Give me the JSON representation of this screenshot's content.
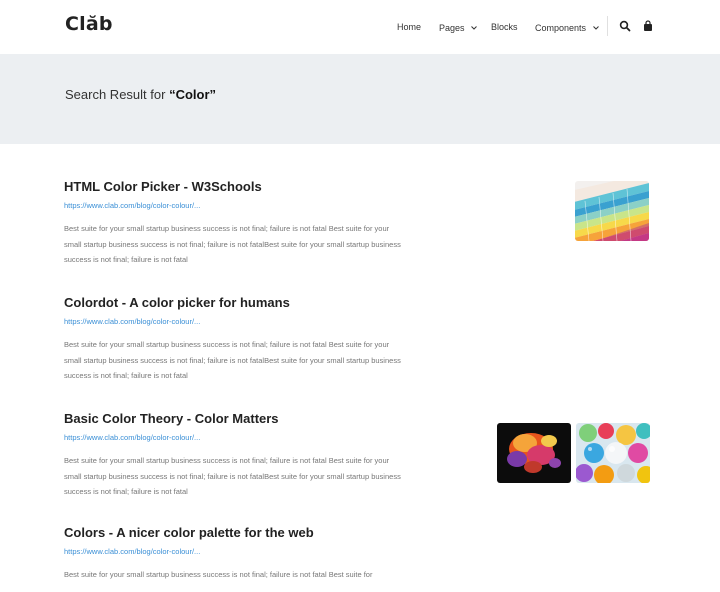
{
  "header": {
    "logo": "Clăb",
    "nav": [
      {
        "label": "Home",
        "dropdown": false
      },
      {
        "label": "Pages",
        "dropdown": true
      },
      {
        "label": "Blocks",
        "dropdown": false
      },
      {
        "label": "Components",
        "dropdown": true
      }
    ],
    "search_icon": "search-icon",
    "cart_icon": "shopping-bag-icon"
  },
  "banner": {
    "prefix": "Search Result for",
    "term": "“Color”"
  },
  "results": [
    {
      "title": "HTML Color Picker - W3Schools",
      "url": "https://www.clab.com/blog/color-colour/...",
      "description": "Best suite for your small startup business success is not final; failure is not fatal Best suite for your small startup business success is not final; failure is not fatalBest suite for your small startup business success is not final; failure is not fatal",
      "images": [
        "color-swatch-fan-image"
      ]
    },
    {
      "title": "Colordot - A color picker for humans",
      "url": "https://www.clab.com/blog/color-colour/...",
      "description": "Best suite for your small startup business success is not final; failure is not fatal Best suite for your small startup business success is not final; failure is not fatalBest suite for your small startup business success is not final; failure is not fatal",
      "images": []
    },
    {
      "title": "Basic Color Theory - Color Matters",
      "url": "https://www.clab.com/blog/color-colour/...",
      "description": "Best suite for your small startup business success is not final; failure is not fatal Best suite for your small startup business success is not final; failure is not fatalBest suite for your small startup business success is not final; failure is not fatal",
      "images": [
        "color-smoke-image",
        "balloons-image"
      ]
    },
    {
      "title": "Colors - A nicer color palette for the web",
      "url": "https://www.clab.com/blog/color-colour/...",
      "description": "Best suite for your small startup business success is not final; failure is not fatal Best suite for",
      "images": []
    }
  ],
  "colors": {
    "link": "#3a8fd6",
    "banner_bg": "#eceff2",
    "title": "#222222",
    "body_text": "#777777"
  }
}
